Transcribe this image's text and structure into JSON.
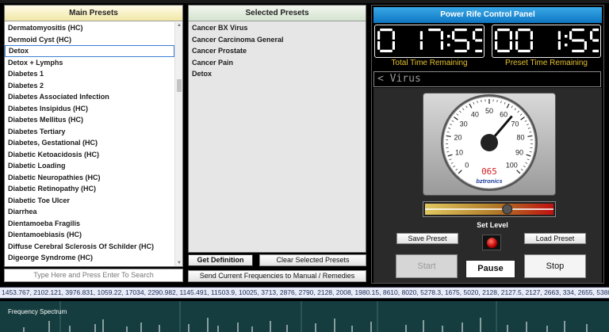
{
  "main_presets": {
    "title": "Main Presets",
    "items": [
      {
        "label": "Dermatomyositis (HC)",
        "selected": false
      },
      {
        "label": "Dermoid Cyst (HC)",
        "selected": false
      },
      {
        "label": "Detox",
        "selected": true
      },
      {
        "label": "Detox + Lymphs",
        "selected": false
      },
      {
        "label": "Diabetes 1",
        "selected": false
      },
      {
        "label": "Diabetes 2",
        "selected": false
      },
      {
        "label": "Diabetes Associated Infection",
        "selected": false
      },
      {
        "label": "Diabetes Insipidus (HC)",
        "selected": false
      },
      {
        "label": "Diabetes Mellitus (HC)",
        "selected": false
      },
      {
        "label": "Diabetes Tertiary",
        "selected": false
      },
      {
        "label": "Diabetes, Gestational (HC)",
        "selected": false
      },
      {
        "label": "Diabetic Ketoacidosis (HC)",
        "selected": false
      },
      {
        "label": "Diabetic Loading",
        "selected": false
      },
      {
        "label": "Diabetic Neuropathies (HC)",
        "selected": false
      },
      {
        "label": "Diabetic Retinopathy (HC)",
        "selected": false
      },
      {
        "label": "Diabetic Toe Ulcer",
        "selected": false
      },
      {
        "label": "Diarrhea",
        "selected": false
      },
      {
        "label": "Dientamoeba Fragilis",
        "selected": false
      },
      {
        "label": "Dientamoebiasis (HC)",
        "selected": false
      },
      {
        "label": "Diffuse Cerebral Sclerosis Of Schilder (HC)",
        "selected": false
      },
      {
        "label": "Digeorge Syndrome (HC)",
        "selected": false
      }
    ],
    "search_placeholder": "Type Here and Press Enter To Search"
  },
  "selected_presets": {
    "title": "Selected Presets",
    "items": [
      "Cancer BX Virus",
      "Cancer Carcinoma General",
      "Cancer Prostate",
      "Cancer Pain",
      "Detox"
    ]
  },
  "buttons": {
    "get_definition": "Get Definition",
    "clear_selected": "Clear Selected Presets",
    "send_frequencies": "Send Current Frequencies to Manual / Remedies",
    "save_preset": "Save Preset",
    "load_preset": "Load Preset",
    "start": "Start",
    "pause": "Pause",
    "stop": "Stop"
  },
  "control_panel": {
    "title": "Power Rife Control Panel",
    "total_time": "0 17:55",
    "total_time_label": "Total Time Remaining",
    "preset_time": "00 1:55",
    "preset_time_label": "Preset Time Remaining",
    "current_program": "< Virus",
    "set_level_label": "Set Level",
    "level_fraction": 0.64
  },
  "gauge": {
    "tick_labels": [
      "0",
      "10",
      "20",
      "30",
      "40",
      "50",
      "60",
      "70",
      "80",
      "90",
      "100"
    ],
    "value": 65,
    "digital_readout": "065",
    "brand": "bztronics"
  },
  "frequency_list": "1453.767, 2102.121, 3976.831, 1059.22, 17034, 2290.982, 1145.491, 11503.9, 10025, 3713, 2876, 2790, 2128, 2008, 1980.15, 8610, 8020, 5278.3, 1675, 5020, 2128, 2127.5, 2127, 2663, 334, 2655, 5388.5",
  "spectrum": {
    "label": "Frequency Spectrum"
  },
  "colors": {
    "title_bar": "#1a8fd8",
    "timer_label": "#e6c12f",
    "digit": "#ffffff",
    "spectrum_bg": "#153c3e"
  }
}
